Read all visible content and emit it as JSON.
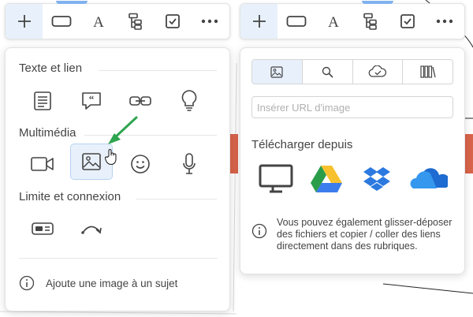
{
  "toolbar_left": {
    "buttons": [
      {
        "name": "add-button",
        "icon": "plus-icon"
      },
      {
        "name": "shape-button",
        "icon": "rectangle-icon"
      },
      {
        "name": "text-button",
        "icon": "text-icon"
      },
      {
        "name": "structure-button",
        "icon": "tree-icon"
      },
      {
        "name": "task-button",
        "icon": "checkbox-icon"
      },
      {
        "name": "more-button",
        "icon": "ellipsis-icon"
      }
    ]
  },
  "menu": {
    "sections": [
      {
        "title": "Texte et lien",
        "items": [
          "note-icon",
          "comment-icon",
          "link-icon",
          "idea-icon"
        ]
      },
      {
        "title": "Multimédia",
        "items": [
          "video-icon",
          "image-icon",
          "emoji-icon",
          "microphone-icon"
        ]
      },
      {
        "title": "Limite et connexion",
        "items": [
          "boundary-icon",
          "connection-icon"
        ]
      }
    ],
    "footer_text": "Ajoute une image à un sujet"
  },
  "image_panel": {
    "tabs": [
      "image-tab",
      "search-tab",
      "cloud-tab",
      "library-tab"
    ],
    "url_placeholder": "Insérer URL d'image",
    "upload_title": "Télécharger depuis",
    "providers": [
      "computer",
      "google-drive",
      "dropbox",
      "onedrive"
    ],
    "info_text": "Vous pouvez également glisser-déposer des fichiers et copier / coller des liens directement dans des rubriques."
  },
  "colors": {
    "accent": "#7fb2ee",
    "selected_bg": "#e8f1fb",
    "arrow": "#2ea44f"
  }
}
